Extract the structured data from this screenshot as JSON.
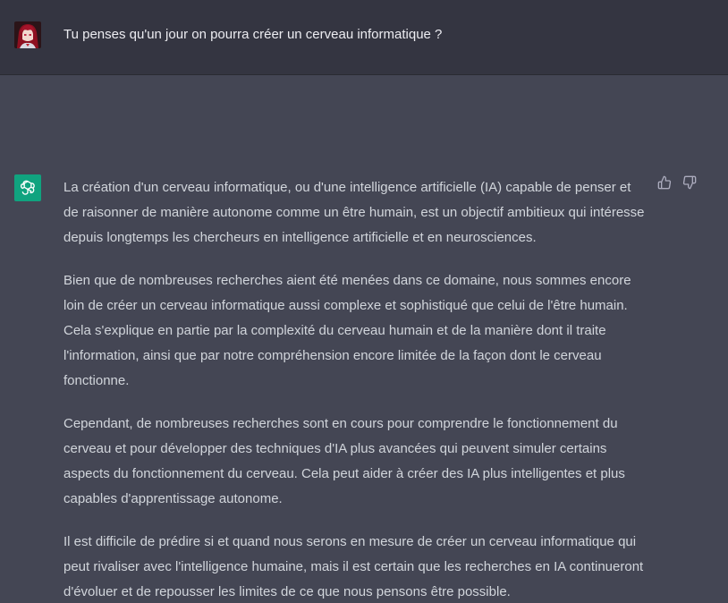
{
  "user_message": {
    "text": "Tu penses qu'un jour on pourra créer un cerveau informatique ?"
  },
  "assistant_message": {
    "paragraphs": [
      "La création d'un cerveau informatique, ou d'une intelligence artificielle (IA) capable de penser et de raisonner de manière autonome comme un être humain, est un objectif ambitieux qui intéresse depuis longtemps les chercheurs en intelligence artificielle et en neurosciences.",
      "Bien que de nombreuses recherches aient été menées dans ce domaine, nous sommes encore loin de créer un cerveau informatique aussi complexe et sophistiqué que celui de l'être humain. Cela s'explique en partie par la complexité du cerveau humain et de la manière dont il traite l'information, ainsi que par notre compréhension encore limitée de la façon dont le cerveau fonctionne.",
      "Cependant, de nombreuses recherches sont en cours pour comprendre le fonctionnement du cerveau et pour développer des techniques d'IA plus avancées qui peuvent simuler certains aspects du fonctionnement du cerveau. Cela peut aider à créer des IA plus intelligentes et plus capables d'apprentissage autonome.",
      "Il est difficile de prédire si et quand nous serons en mesure de créer un cerveau informatique qui peut rivaliser avec l'intelligence humaine, mais il est certain que les recherches en IA continueront d'évoluer et de repousser les limites de ce que nous pensons être possible."
    ]
  },
  "icons": {
    "user_avatar": "user-avatar",
    "bot_avatar": "openai-logo-icon",
    "like": "thumbs-up-icon",
    "dislike": "thumbs-down-icon"
  },
  "colors": {
    "user_bg": "#343541",
    "assistant_bg": "#444654",
    "bot_avatar_bg": "#10a37f",
    "text_user": "#ececf1",
    "text_assistant": "#d1d5db"
  }
}
